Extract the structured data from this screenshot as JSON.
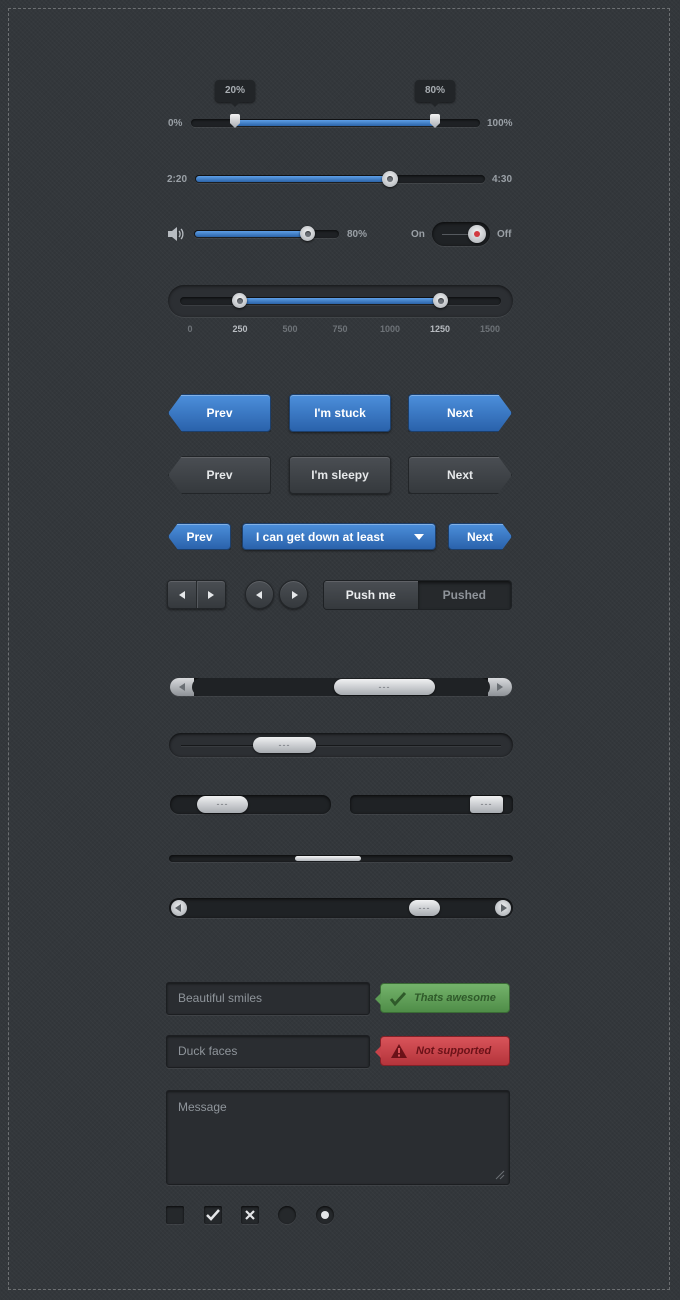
{
  "range_slider": {
    "min_label": "0%",
    "max_label": "100%",
    "low_tip": "20%",
    "high_tip": "80%",
    "low": 0.2,
    "high": 0.8
  },
  "time_slider": {
    "current": "2:20",
    "total": "4:30",
    "progress": 0.66
  },
  "volume": {
    "value_label": "80%",
    "level": 0.8,
    "icon": "speaker-icon"
  },
  "toggle": {
    "on_label": "On",
    "off_label": "Off",
    "state": "off"
  },
  "scale_slider": {
    "ticks": [
      "0",
      "250",
      "500",
      "750",
      "1000",
      "1250",
      "1500"
    ],
    "low": 250,
    "high": 1250
  },
  "blue_row": {
    "prev": "Prev",
    "middle": "I'm stuck",
    "next": "Next"
  },
  "dark_row": {
    "prev": "Prev",
    "middle": "I'm sleepy",
    "next": "Next"
  },
  "small_row": {
    "prev": "Prev",
    "dropdown": "I can get down at least",
    "next": "Next"
  },
  "controls_row": {
    "push": "Push me",
    "pushed": "Pushed"
  },
  "scrollbars": {
    "grip": "---"
  },
  "form": {
    "field1": "Beautiful smiles",
    "field1_status": "Thats awesome",
    "field2": "Duck faces",
    "field2_status": "Not supported",
    "message_placeholder": "Message"
  },
  "colors": {
    "accent": "#3b7cc9",
    "success": "#5e9e56",
    "error": "#c6434a",
    "background": "#33373b"
  }
}
